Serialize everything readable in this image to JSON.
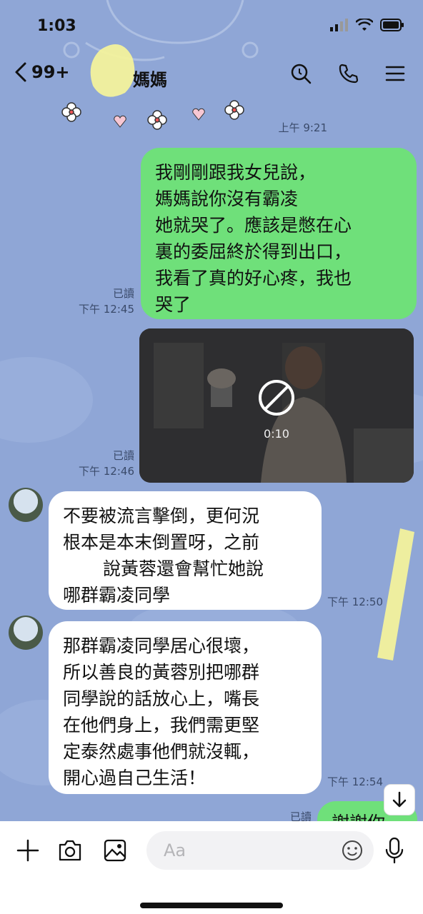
{
  "status": {
    "time": "1:03"
  },
  "header": {
    "back_count": "99+",
    "title": "媽媽"
  },
  "messages": {
    "top_time": "上午 9:21",
    "out1": {
      "lines": [
        "我剛剛跟我女兒說，",
        "媽媽說你沒有霸凌",
        "她就哭了。應該是憋在心",
        "裏的委屈終於得到出口，",
        "我看了真的好心疼，我也",
        "哭了"
      ],
      "read": "已讀",
      "time": "下午 12:45"
    },
    "video": {
      "duration": "0:10",
      "read": "已讀",
      "time": "下午 12:46"
    },
    "in1": {
      "lines": [
        "不要被流言擊倒，更何況",
        "根本是本末倒置呀，之前",
        "說黃蓉還會幫忙她說",
        "哪群霸凌同學"
      ],
      "time": "下午 12:50"
    },
    "in2": {
      "lines": [
        "那群霸凌同學居心很壞，",
        "所以善良的黃蓉別把哪群",
        "同學說的話放心上，嘴長",
        "在他們身上，我們需更堅",
        "定泰然處事他們就沒輒，",
        "開心過自己生活！"
      ],
      "time": "下午 12:54"
    },
    "out2": {
      "read": "已讀",
      "text": "謝謝你"
    }
  },
  "composer": {
    "placeholder": "Aa"
  },
  "colors": {
    "background": "#8fa6d6",
    "outgoing": "#6fe07a",
    "incoming": "#ffffff"
  },
  "icons": [
    "back-chevron-icon",
    "search-icon",
    "phone-icon",
    "menu-icon",
    "add-icon",
    "camera-icon",
    "image-icon",
    "emoji-icon",
    "mic-icon",
    "blocked-icon",
    "arrow-down-icon"
  ]
}
